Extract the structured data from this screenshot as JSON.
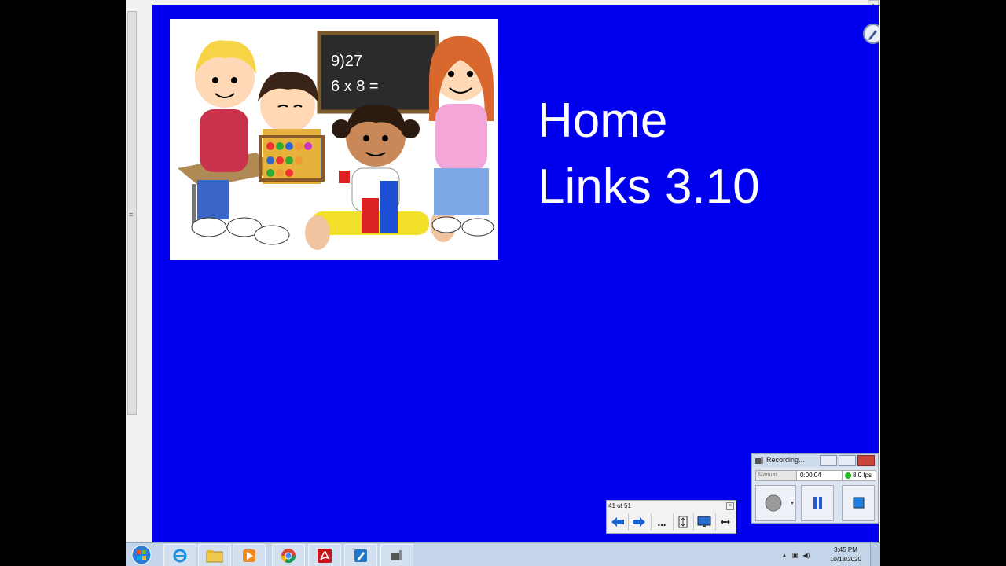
{
  "slide": {
    "title_line1": "Home",
    "title_line2": "Links 3.10",
    "background": "#0000ee",
    "clipart": {
      "chalkboard_line1": "9)27",
      "chalkboard_line2": "6 x 8 ="
    }
  },
  "slide_nav": {
    "counter": "41 of 51",
    "more_label": "...",
    "icons": [
      "arrow-left-icon",
      "arrow-right-icon",
      "more-icon",
      "page-icon",
      "screen-icon",
      "resize-icon"
    ]
  },
  "recorder": {
    "title": "Recording...",
    "mode": "Manual",
    "elapsed": "0:00:04",
    "fps": "8.0 fps"
  },
  "taskbar": {
    "time": "3:45 PM",
    "date": "10/18/2020",
    "apps": [
      "ie-icon",
      "folder-icon",
      "media-player-icon",
      "chrome-icon",
      "acrobat-icon",
      "notebook-icon",
      "recorder-app-icon"
    ]
  }
}
